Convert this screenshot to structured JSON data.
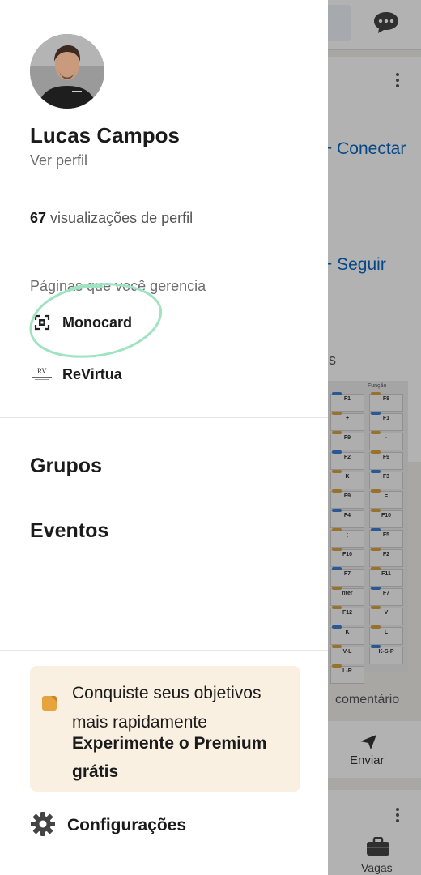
{
  "profile": {
    "name": "Lucas Campos",
    "view_profile_label": "Ver perfil",
    "views_count": "67",
    "views_label": "visualizações de perfil"
  },
  "pages": {
    "heading": "Páginas que você gerencia",
    "items": [
      {
        "label": "Monocard",
        "icon": "monocard-logo-icon"
      },
      {
        "label": "ReVirtua",
        "icon": "revirtua-logo-icon"
      }
    ]
  },
  "nav": {
    "groups_label": "Grupos",
    "events_label": "Eventos"
  },
  "promo": {
    "line1": "Conquiste seus objetivos mais rapidamente",
    "line2": "Experimente o Premium grátis",
    "icon": "premium-badge-icon",
    "accent": "#e7a33e",
    "background": "#f9f0e1"
  },
  "settings": {
    "label": "Configurações",
    "icon": "gear-icon"
  },
  "background_feed": {
    "connect_label": "Conectar",
    "follow_label": "Seguir",
    "truncated_s": "s",
    "keyboard_header": "Função",
    "comment_label": "comentário",
    "send_label": "Enviar",
    "jobs_label": "Vagas",
    "link_color": "#0a66c2"
  },
  "keyboard_keys": [
    "F1",
    "F8",
    "+",
    "F1",
    "F9",
    "-",
    "F2",
    "F9",
    "K",
    "F3",
    "F9",
    "=",
    "F4",
    "F10",
    ";",
    "F5",
    "F10",
    "F2",
    "F7",
    "F11",
    "nter",
    "F7",
    "F12",
    "V",
    "K",
    "L",
    "V-L",
    "K-S-P",
    "L-R"
  ]
}
